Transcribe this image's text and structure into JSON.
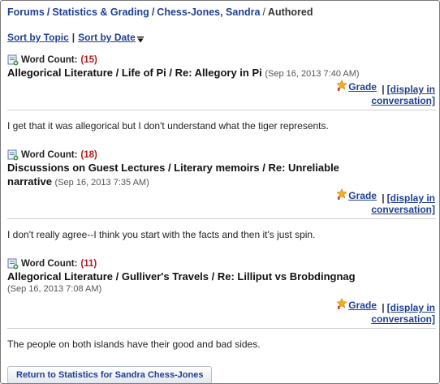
{
  "breadcrumb": {
    "items": [
      "Forums",
      "Statistics & Grading",
      "Chess-Jones, Sandra"
    ],
    "current": "Authored"
  },
  "sort": {
    "by_topic": "Sort by Topic",
    "separator": "|",
    "by_date": "Sort by Date"
  },
  "posts": [
    {
      "word_count_label": "Word Count:",
      "word_count": "(15)",
      "title": "Allegorical Literature / Life of Pi / Re: Allegory in Pi",
      "date": "(Sep 16, 2013 7:40 AM)",
      "grade_label": "Grade",
      "display_line1": "[display in",
      "display_line2": "conversation]",
      "body": "I get that it was allegorical but I don't understand what the tiger represents."
    },
    {
      "word_count_label": "Word Count:",
      "word_count": "(18)",
      "title_line1": "Discussions on Guest Lectures / Literary memoirs / Re: Unreliable",
      "title_line2": "narrative",
      "date": "(Sep 16, 2013 7:35 AM)",
      "grade_label": "Grade",
      "display_line1": "[display in",
      "display_line2": "conversation]",
      "body": "I don't really agree--I think you start with the facts and then it's just spin."
    },
    {
      "word_count_label": "Word Count:",
      "word_count": "(11)",
      "title": "Allegorical Literature / Gulliver's Travels / Re: Lilliput vs Brobdingnag",
      "date": "(Sep 16, 2013 7:08 AM)",
      "grade_label": "Grade",
      "display_line1": "[display in",
      "display_line2": "conversation]",
      "body": "The people on both islands have their good and bad sides."
    }
  ],
  "return_button": "Return to Statistics for Sandra Chess-Jones",
  "icons": {
    "word_count": "document-icon",
    "grade": "star-ribbon-icon",
    "sort": "sort-descending-icon"
  },
  "colors": {
    "link": "#1f3f8f",
    "count": "#b31b1b",
    "divider": "#cfcfcf"
  }
}
